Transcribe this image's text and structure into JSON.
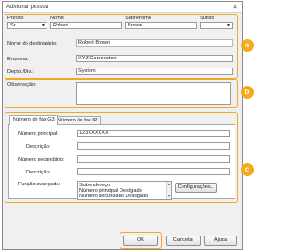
{
  "window": {
    "title": "Adicionar pessoa",
    "close_glyph": "✕"
  },
  "name_section": {
    "prefix": {
      "label": "Prefixo",
      "value": "Sr."
    },
    "first_name": {
      "label": "Nome",
      "value": "Robert"
    },
    "last_name": {
      "label": "Sobrenome",
      "value": "Brown"
    },
    "suffix": {
      "label": "Sufixo",
      "value": ""
    },
    "display_name": {
      "label": "Nome do destinatário:",
      "value": "Robert Brown"
    },
    "company": {
      "label": "Empresa:",
      "value": "XYZ Corporation"
    },
    "department": {
      "label": "Depto./Div.:",
      "value": "System"
    }
  },
  "notes": {
    "label": "Observação:",
    "value": ""
  },
  "tabs": [
    {
      "label": "Número de fax G3",
      "active": true
    },
    {
      "label": "Número de fax IP",
      "active": false
    }
  ],
  "fax": {
    "main_number": {
      "label": "Número principal:",
      "value": "123XXXXXX"
    },
    "main_description": {
      "label": "Descrição:",
      "value": ""
    },
    "secondary_number": {
      "label": "Número secundário:",
      "value": ""
    },
    "secondary_description": {
      "label": "Descrição:",
      "value": ""
    },
    "advanced": {
      "label": "Função avançada:",
      "lines": [
        "Subendereço",
        "Número principal    Desligado",
        "Número secundário  Desligado"
      ],
      "settings_button": "Configurações..."
    }
  },
  "buttons": {
    "ok": "OK",
    "cancel": "Cancelar",
    "help": "Ajuda"
  },
  "callouts": {
    "a": "a",
    "b": "b",
    "c": "c"
  },
  "colors": {
    "highlight": "#f5a623",
    "badge": "#f7a81b"
  }
}
